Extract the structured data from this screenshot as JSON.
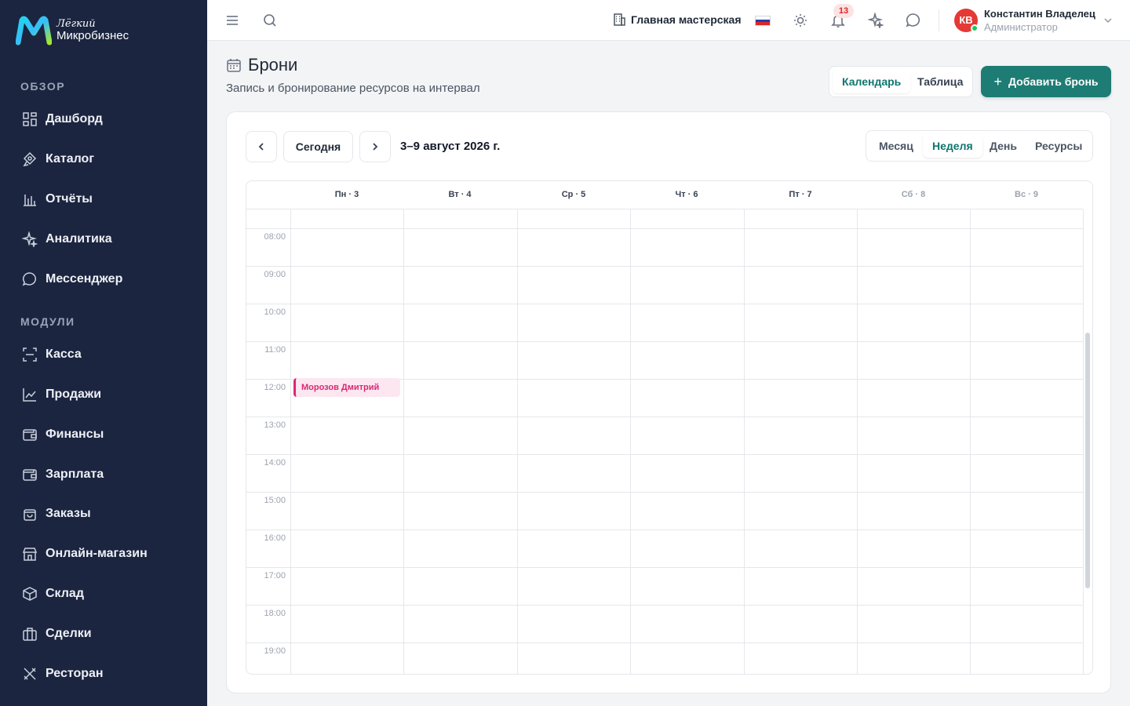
{
  "brand": {
    "line1": "Лёгкий",
    "line2": "Микробизнес"
  },
  "sidebar": {
    "sections": [
      {
        "title": "ОБЗОР",
        "items": [
          {
            "label": "Дашборд",
            "icon": "dashboard-icon"
          },
          {
            "label": "Каталог",
            "icon": "catalog-icon"
          },
          {
            "label": "Отчёты",
            "icon": "reports-icon"
          },
          {
            "label": "Аналитика",
            "icon": "sparkle-icon"
          },
          {
            "label": "Мессенджер",
            "icon": "chat-icon"
          }
        ]
      },
      {
        "title": "МОДУЛИ",
        "items": [
          {
            "label": "Касса",
            "icon": "scan-icon"
          },
          {
            "label": "Продажи",
            "icon": "chart-line-icon"
          },
          {
            "label": "Финансы",
            "icon": "wallet-icon"
          },
          {
            "label": "Зарплата",
            "icon": "wallet-icon"
          },
          {
            "label": "Заказы",
            "icon": "bag-icon"
          },
          {
            "label": "Онлайн-магазин",
            "icon": "store-icon"
          },
          {
            "label": "Склад",
            "icon": "box-icon"
          },
          {
            "label": "Сделки",
            "icon": "briefcase-icon"
          },
          {
            "label": "Ресторан",
            "icon": "utensils-icon"
          }
        ]
      }
    ]
  },
  "topbar": {
    "workshop": "Главная мастерская",
    "notifications_count": "13",
    "user": {
      "initials": "КВ",
      "name": "Константин Владелец",
      "role": "Администратор"
    }
  },
  "page": {
    "title": "Брони",
    "subtitle": "Запись и бронирование ресурсов на интервал",
    "view_toggle": {
      "calendar": "Календарь",
      "table": "Таблица"
    },
    "add_button": "Добавить бронь"
  },
  "calendar": {
    "today_button": "Сегодня",
    "range": "3–9 август 2026 г.",
    "modes": [
      "Месяц",
      "Неделя",
      "День",
      "Ресурсы"
    ],
    "active_mode": "Неделя",
    "days": [
      "Пн · 3",
      "Вт · 4",
      "Ср · 5",
      "Чт · 6",
      "Пт · 7",
      "Сб · 8",
      "Вс · 9"
    ],
    "hours": [
      "08:00",
      "09:00",
      "10:00",
      "11:00",
      "12:00",
      "13:00",
      "14:00",
      "15:00",
      "16:00",
      "17:00",
      "18:00",
      "19:00"
    ],
    "events": [
      {
        "title": "Морозов Дмитрий",
        "day": "Пн · 3",
        "start": "12:00",
        "color": "#db2777"
      }
    ]
  },
  "colors": {
    "sidebar_bg": "#1b2540",
    "accent": "#1d7c74",
    "event_pink": "#db2777"
  }
}
